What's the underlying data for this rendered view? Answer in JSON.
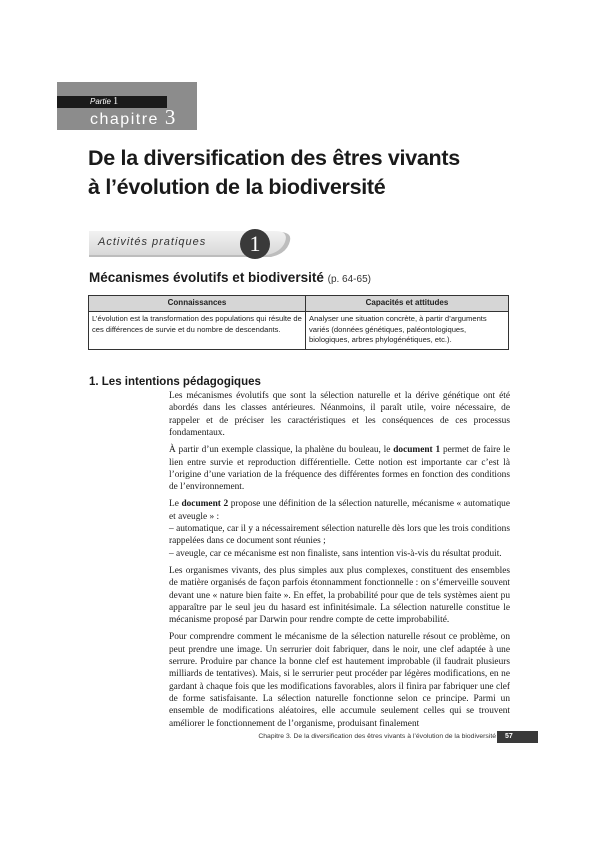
{
  "header": {
    "partie_label": "Partie",
    "partie_number": "1",
    "chapitre_label": "chapitre",
    "chapitre_number": "3"
  },
  "title": {
    "line1": "De la diversification des êtres vivants",
    "line2": "à l’évolution de la biodiversité"
  },
  "activity_badge": {
    "label": "Activités pratiques",
    "number": "1"
  },
  "section": {
    "heading": "Mécanismes évolutifs et biodiversité",
    "pages": "(p. 64-65)"
  },
  "table": {
    "headers": [
      "Connaissances",
      "Capacités et attitudes"
    ],
    "row": [
      "L’évolution est la transformation des populations qui résulte de ces différences de survie et du nombre de descendants.",
      "Analyser une situation concrète, à partir d’arguments variés (données génétiques, paléontologiques, biologiques, arbres phylogénétiques, etc.)."
    ]
  },
  "subheading": "1. Les intentions pédagogiques",
  "paragraphs": {
    "p1": "Les mécanismes évolutifs que sont la sélection naturelle et la dérive génétique ont été abordés dans les classes antérieures. Néanmoins, il paraît utile, voire nécessaire, de rappeler et de préciser les caractéristiques et les conséquences de ces processus fondamentaux.",
    "p2_before": "À partir d’un exemple classique, la phalène du bouleau, le ",
    "p2_bold": "document 1",
    "p2_after": " permet de faire le lien entre survie et reproduction différentielle. Cette notion est importante car c’est là l’origine d’une variation de la fréquence des différentes formes en fonction des conditions de l’environnement.",
    "p3_before": "Le ",
    "p3_bold": "document 2",
    "p3_after": " propose une définition de la sélection naturelle, mécanisme « automatique et aveugle » :",
    "p4": "– automatique, car il y a nécessairement sélection naturelle dès lors que les trois conditions rappelées dans ce document sont réunies ;",
    "p5": "– aveugle, car ce mécanisme est non finaliste, sans intention vis-à-vis du résultat produit.",
    "p6": "Les organismes vivants, des plus simples aux plus complexes, constituent des ensembles de matière organisés de façon parfois étonnamment fonctionnelle : on s’émerveille souvent devant une « nature bien faite ». En effet, la probabilité pour que de tels systèmes aient pu apparaître par le seul jeu du hasard est infinitésimale. La sélection naturelle constitue le mécanisme proposé par Darwin pour rendre compte de cette improbabilité.",
    "p7": "Pour comprendre comment le mécanisme de la sélection naturelle résout ce problème, on peut prendre une image. Un serrurier doit fabriquer, dans le noir, une clef adaptée à une serrure. Produire par chance la bonne clef est hautement improbable (il faudrait plusieurs milliards de tentatives). Mais, si le serrurier peut procéder par légères modifications, en ne gardant à chaque fois que les modifications favorables, alors il finira par fabriquer une clef de forme satisfaisante. La sélection naturelle fonctionne selon ce principe. Parmi un ensemble de modifications aléatoires, elle accumule seulement celles qui se trouvent améliorer le fonctionnement de l’organisme, produisant finalement"
  },
  "footer": {
    "running_title": "Chapitre 3. De la diversification des êtres vivants à l’évolution de la biodiversité",
    "page_number": "57"
  }
}
